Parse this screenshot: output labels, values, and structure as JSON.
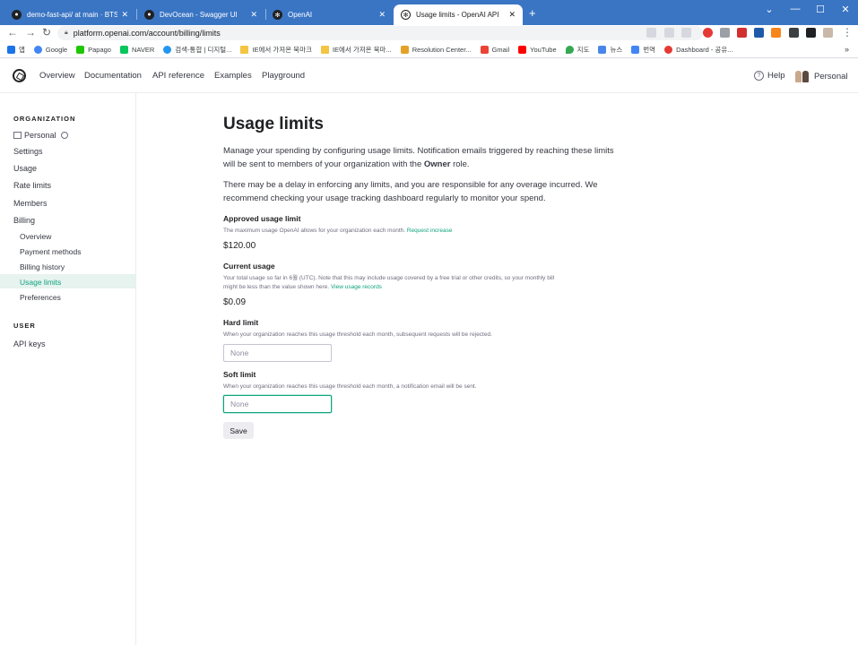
{
  "browser": {
    "tabs": [
      {
        "title": "demo-fast-api/ at main · BTSQ...",
        "icon": "github-icon"
      },
      {
        "title": "DevOcean - Swagger UI",
        "icon": "devocean-icon"
      },
      {
        "title": "OpenAI",
        "icon": "openai-icon"
      },
      {
        "title": "Usage limits - OpenAI API",
        "icon": "openai-icon",
        "active": true
      }
    ],
    "url": "platform.openai.com/account/billing/limits",
    "bookmarks": [
      "앱",
      "Google",
      "Papago",
      "NAVER",
      "검색-통합 | 디지털...",
      "IE에서 가져온 북마크",
      "IE에서 가져온 북마...",
      "Resolution Center...",
      "Gmail",
      "YouTube",
      "지도",
      "뉴스",
      "번역",
      "Dashboard - 공유..."
    ]
  },
  "header": {
    "nav": [
      "Overview",
      "Documentation",
      "API reference",
      "Examples",
      "Playground"
    ],
    "help": "Help",
    "account": "Personal"
  },
  "sidebar": {
    "org_heading": "ORGANIZATION",
    "org_name": "Personal",
    "items": [
      "Settings",
      "Usage",
      "Rate limits",
      "Members",
      "Billing"
    ],
    "billing_items": [
      "Overview",
      "Payment methods",
      "Billing history",
      "Usage limits",
      "Preferences"
    ],
    "active_item": "Usage limits",
    "user_heading": "USER",
    "user_items": [
      "API keys"
    ]
  },
  "main": {
    "title": "Usage limits",
    "intro_prefix": "Manage your spending by configuring usage limits. Notification emails triggered by reaching these limits will be sent to members of your organization with the ",
    "intro_role": "Owner",
    "intro_suffix": " role.",
    "delay_note": "There may be a delay in enforcing any limits, and you are responsible for any overage incurred. We recommend checking your usage tracking dashboard regularly to monitor your spend.",
    "approved": {
      "label": "Approved usage limit",
      "hint": "The maximum usage OpenAI allows for your organization each month.",
      "link": "Request increase",
      "value": "$120.00"
    },
    "current": {
      "label": "Current usage",
      "hint": "Your total usage so far in 6월 (UTC). Note that this may include usage covered by a free trial or other credits, so your monthly bill might be less than the value shown here.",
      "link": "View usage records",
      "value": "$0.09"
    },
    "hard_limit": {
      "label": "Hard limit",
      "hint": "When your organization reaches this usage threshold each month, subsequent requests will be rejected.",
      "placeholder": "None"
    },
    "soft_limit": {
      "label": "Soft limit",
      "hint": "When your organization reaches this usage threshold each month, a notification email will be sent.",
      "placeholder": "None"
    },
    "save_label": "Save"
  },
  "colors": {
    "accent": "#10a37f",
    "tabstrip": "#3a75c4",
    "active_bg": "#e6f3ef"
  }
}
